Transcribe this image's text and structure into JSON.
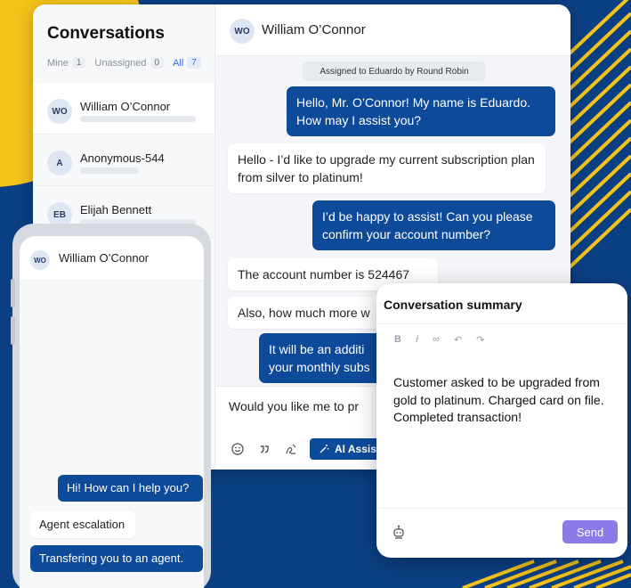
{
  "colors": {
    "background": "#0b3f84",
    "accent_yellow": "#f4c21a",
    "outgoing_bubble": "#0d4a9a",
    "send_button": "#8d7ae6"
  },
  "sidebar": {
    "title": "Conversations",
    "filters": [
      {
        "label": "Mine",
        "count": "1"
      },
      {
        "label": "Unassigned",
        "count": "0"
      },
      {
        "label": "All",
        "count": "7"
      }
    ],
    "conversations": [
      {
        "initials": "WO",
        "name": "William O’Connor"
      },
      {
        "initials": "A",
        "name": "Anonymous-544"
      },
      {
        "initials": "EB",
        "name": "Elijah Bennett"
      }
    ]
  },
  "main": {
    "header": {
      "initials": "WO",
      "name": "William O’Connor"
    },
    "system_badge": "Assigned to Eduardo by Round Robin",
    "messages": [
      {
        "dir": "out",
        "text": "Hello, Mr. O’Connor! My name is Eduardo. How may I assist you?"
      },
      {
        "dir": "in",
        "text": "Hello - I’d like to upgrade my current subscription plan from silver to platinum!"
      },
      {
        "dir": "out",
        "text": "I’d be happy to assist! Can you please confirm your account number?"
      },
      {
        "dir": "in",
        "text": "The account number is 524467"
      },
      {
        "dir": "in",
        "text": "Also, how much more w"
      },
      {
        "dir": "out",
        "text": "It will be an additi your monthly subs"
      }
    ],
    "composer_text": "Would you like me to pr",
    "toolbar": {
      "icons": [
        "emoji-icon",
        "quote-icon",
        "signature-icon"
      ],
      "ai_label": "AI Assis"
    }
  },
  "phone": {
    "header": {
      "initials": "WO",
      "name": "William O’Connor"
    },
    "messages": [
      {
        "dir": "out",
        "text": "Hi! How can I help you?"
      },
      {
        "dir": "in",
        "text": "Agent escalation"
      },
      {
        "dir": "out",
        "text": "Transfering you to an agent."
      }
    ]
  },
  "summary": {
    "title": "Conversation summary",
    "toolbar": [
      "B",
      "I",
      "∞",
      "↶",
      "↷"
    ],
    "text": "Customer asked to be upgraded from gold to platinum. Charged card on file. Completed transaction!",
    "send_label": "Send"
  }
}
